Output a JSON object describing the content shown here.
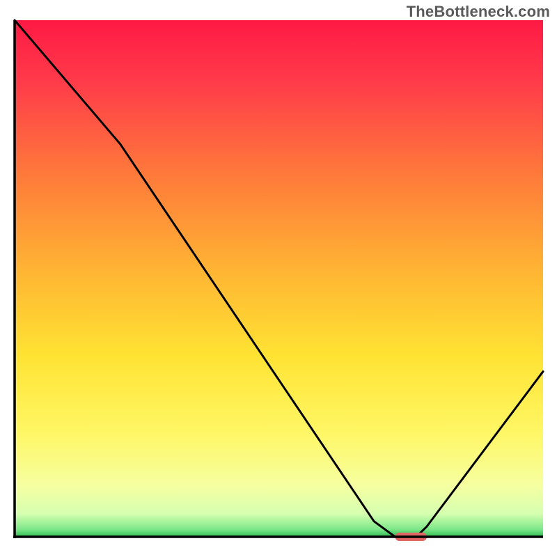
{
  "watermark": "TheBottleneck.com",
  "chart_data": {
    "type": "line",
    "title": "",
    "xlabel": "",
    "ylabel": "",
    "xlim": [
      0,
      100
    ],
    "ylim": [
      0,
      100
    ],
    "series": [
      {
        "name": "bottleneck-curve",
        "x": [
          0,
          20,
          68,
          72,
          76,
          78,
          100
        ],
        "y": [
          100,
          76,
          3,
          0,
          0,
          2,
          32
        ]
      }
    ],
    "marker": {
      "name": "current-position",
      "x_start": 72,
      "x_end": 78,
      "y": 0,
      "color": "#e06666"
    },
    "background_gradient": {
      "stops": [
        {
          "offset": 0.0,
          "color": "#ff1a44"
        },
        {
          "offset": 0.12,
          "color": "#ff3b4a"
        },
        {
          "offset": 0.3,
          "color": "#ff7a3a"
        },
        {
          "offset": 0.5,
          "color": "#ffb933"
        },
        {
          "offset": 0.65,
          "color": "#ffe333"
        },
        {
          "offset": 0.8,
          "color": "#fff766"
        },
        {
          "offset": 0.9,
          "color": "#f6ffa0"
        },
        {
          "offset": 0.955,
          "color": "#d6ffb0"
        },
        {
          "offset": 0.985,
          "color": "#7fe88a"
        },
        {
          "offset": 1.0,
          "color": "#2dbb52"
        }
      ]
    },
    "axes": {
      "color": "#000000",
      "width": 3.5
    }
  }
}
